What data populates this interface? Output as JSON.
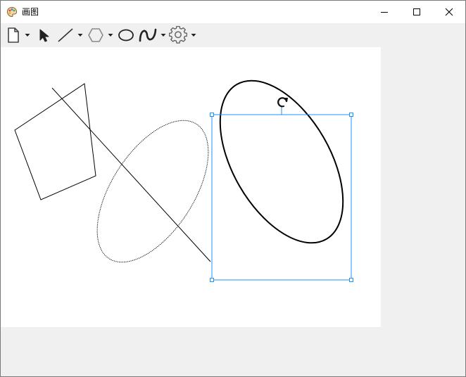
{
  "window": {
    "title": "画图"
  },
  "toolbar": {
    "tools": [
      {
        "name": "new-document",
        "icon": "document-icon"
      },
      {
        "name": "select",
        "icon": "cursor-arrow-icon"
      },
      {
        "name": "line",
        "icon": "line-icon"
      },
      {
        "name": "polygon",
        "icon": "hexagon-icon"
      },
      {
        "name": "ellipse",
        "icon": "ellipse-icon"
      },
      {
        "name": "curve",
        "icon": "curve-icon"
      },
      {
        "name": "settings",
        "icon": "gear-icon"
      }
    ]
  },
  "canvas": {
    "shapes": [
      "polygon",
      "line",
      "ellipse-dotted",
      "ellipse-selected"
    ],
    "selection_color": "#1e90ff"
  },
  "colors": {
    "titlebar": "#ffffff",
    "toolbar": "#f0f0f0",
    "canvas": "#ffffff",
    "workspace": "#f0f0f0"
  }
}
